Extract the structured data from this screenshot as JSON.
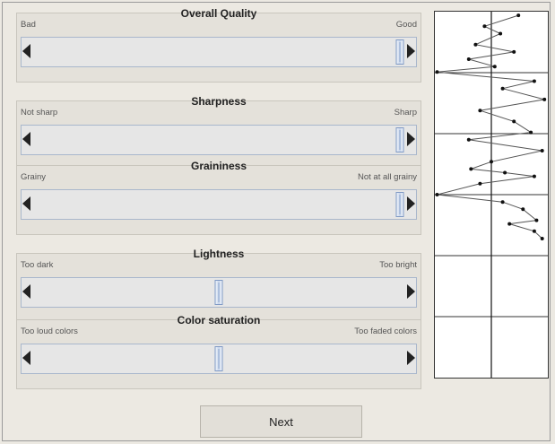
{
  "sliders": [
    {
      "title": "Overall Quality",
      "left_label": "Bad",
      "right_label": "Good",
      "value": 0.985
    },
    {
      "title": "Sharpness",
      "left_label": "Not sharp",
      "right_label": "Sharp",
      "value": 0.985
    },
    {
      "title": "Graininess",
      "left_label": "Grainy",
      "right_label": "Not at all grainy",
      "value": 0.985
    },
    {
      "title": "Lightness",
      "left_label": "Too dark",
      "right_label": "Too bright",
      "value": 0.5
    },
    {
      "title": "Color saturation",
      "left_label": "Too loud colors",
      "right_label": "Too faded colors",
      "value": 0.5
    }
  ],
  "next_button": {
    "label": "Next"
  },
  "history_plot": {
    "center_line": 0.5,
    "points": [
      [
        0.74,
        0.01
      ],
      [
        0.44,
        0.04
      ],
      [
        0.58,
        0.06
      ],
      [
        0.36,
        0.09
      ],
      [
        0.7,
        0.11
      ],
      [
        0.3,
        0.13
      ],
      [
        0.53,
        0.15
      ],
      [
        0.02,
        0.165
      ],
      [
        0.88,
        0.19
      ],
      [
        0.6,
        0.21
      ],
      [
        0.97,
        0.24
      ],
      [
        0.4,
        0.27
      ],
      [
        0.7,
        0.3
      ],
      [
        0.85,
        0.33
      ],
      [
        0.3,
        0.35
      ],
      [
        0.95,
        0.38
      ],
      [
        0.5,
        0.41
      ],
      [
        0.32,
        0.43
      ],
      [
        0.62,
        0.44
      ],
      [
        0.88,
        0.45
      ],
      [
        0.4,
        0.47
      ],
      [
        0.02,
        0.5
      ],
      [
        0.6,
        0.52
      ],
      [
        0.78,
        0.54
      ],
      [
        0.9,
        0.57
      ],
      [
        0.66,
        0.58
      ],
      [
        0.88,
        0.6
      ],
      [
        0.95,
        0.62
      ]
    ],
    "colors": {
      "line": "#555555",
      "dot": "#111111",
      "grid": "#333333"
    }
  }
}
